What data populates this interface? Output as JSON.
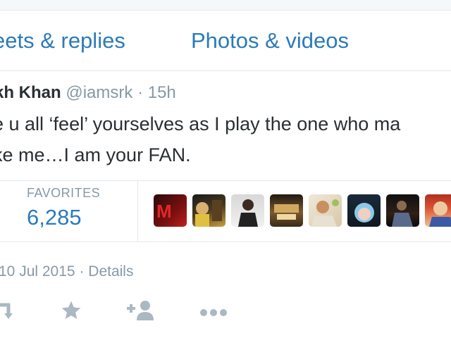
{
  "tabs": {
    "replies_label": "eets & replies",
    "photos_label": "Photos & videos"
  },
  "tweet": {
    "author_name": "kh Khan",
    "handle": "@iamsrk",
    "separator": "·",
    "time": "15h",
    "text_line1": "e u all ‘feel’ yourselves as I play the one who ma",
    "text_line2": "ke me…I am your FAN."
  },
  "stats": {
    "favorites_label": "FAVORITES",
    "favorites_count": "6,285"
  },
  "footer": {
    "date": "10 Jul 2015",
    "separator": "·",
    "details_label": "Details"
  },
  "icons": {
    "retweet": "retweet-icon",
    "favorite": "star-icon",
    "follow": "follow-icon",
    "more": "more-icon"
  },
  "colors": {
    "link_blue": "#2b7bb9",
    "muted_gray": "#8899a6",
    "text": "#292f33",
    "border": "#e1e8ed",
    "icon_gray": "#aab8c2"
  }
}
